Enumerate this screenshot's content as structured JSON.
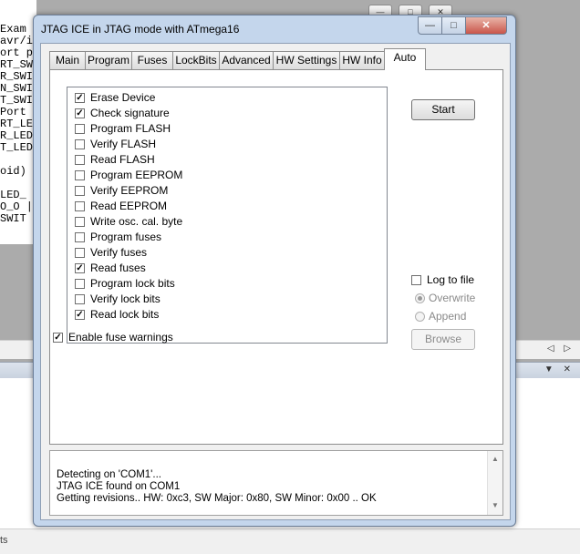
{
  "background": {
    "editor_lines": [
      "Exam",
      "avr/i",
      "ort p",
      "RT_SW",
      "R_SWI",
      "N_SWI",
      "T_SWI",
      "Port ",
      "RT_LE",
      "R_LED",
      "T_LED",
      "",
      "oid)",
      "",
      "LED_",
      "O_O |",
      "SWIT"
    ],
    "status_text": "ts",
    "window_min": "—",
    "window_max": "□",
    "window_close": "✕",
    "scroll_left": "◁",
    "scroll_right": "▷",
    "panel_dropdown": "▼",
    "panel_close": "✕"
  },
  "dialog": {
    "title": "JTAG ICE in JTAG mode with ATmega16",
    "minimize": "—",
    "maximize": "□",
    "close": "✕",
    "tabs": [
      "Main",
      "Program",
      "Fuses",
      "LockBits",
      "Advanced",
      "HW Settings",
      "HW Info",
      "Auto"
    ],
    "active_tab": "Auto",
    "tasks": [
      {
        "label": "Erase Device",
        "checked": true
      },
      {
        "label": "Check signature",
        "checked": true
      },
      {
        "label": "Program FLASH",
        "checked": false
      },
      {
        "label": "Verify FLASH",
        "checked": false
      },
      {
        "label": "Read FLASH",
        "checked": false
      },
      {
        "label": "Program EEPROM",
        "checked": false
      },
      {
        "label": "Verify EEPROM",
        "checked": false
      },
      {
        "label": "Read EEPROM",
        "checked": false
      },
      {
        "label": "Write osc. cal. byte",
        "checked": false
      },
      {
        "label": "Program fuses",
        "checked": false
      },
      {
        "label": "Verify fuses",
        "checked": false
      },
      {
        "label": "Read fuses",
        "checked": true
      },
      {
        "label": "Program lock bits",
        "checked": false
      },
      {
        "label": "Verify lock bits",
        "checked": false
      },
      {
        "label": "Read lock bits",
        "checked": true
      }
    ],
    "enable_fuse_warnings": {
      "label": "Enable fuse warnings",
      "checked": true
    },
    "start_button": "Start",
    "log_to_file": {
      "label": "Log to file",
      "checked": false
    },
    "overwrite": {
      "label": "Overwrite",
      "selected": true
    },
    "append": {
      "label": "Append",
      "selected": false
    },
    "browse_button": "Browse",
    "log_lines": [
      "Detecting on 'COM1'...",
      "JTAG ICE found on COM1",
      "Getting revisions.. HW: 0xc3, SW Major: 0x80, SW Minor: 0x00 .. OK"
    ],
    "scroll_up": "▲",
    "scroll_down": "▼"
  }
}
